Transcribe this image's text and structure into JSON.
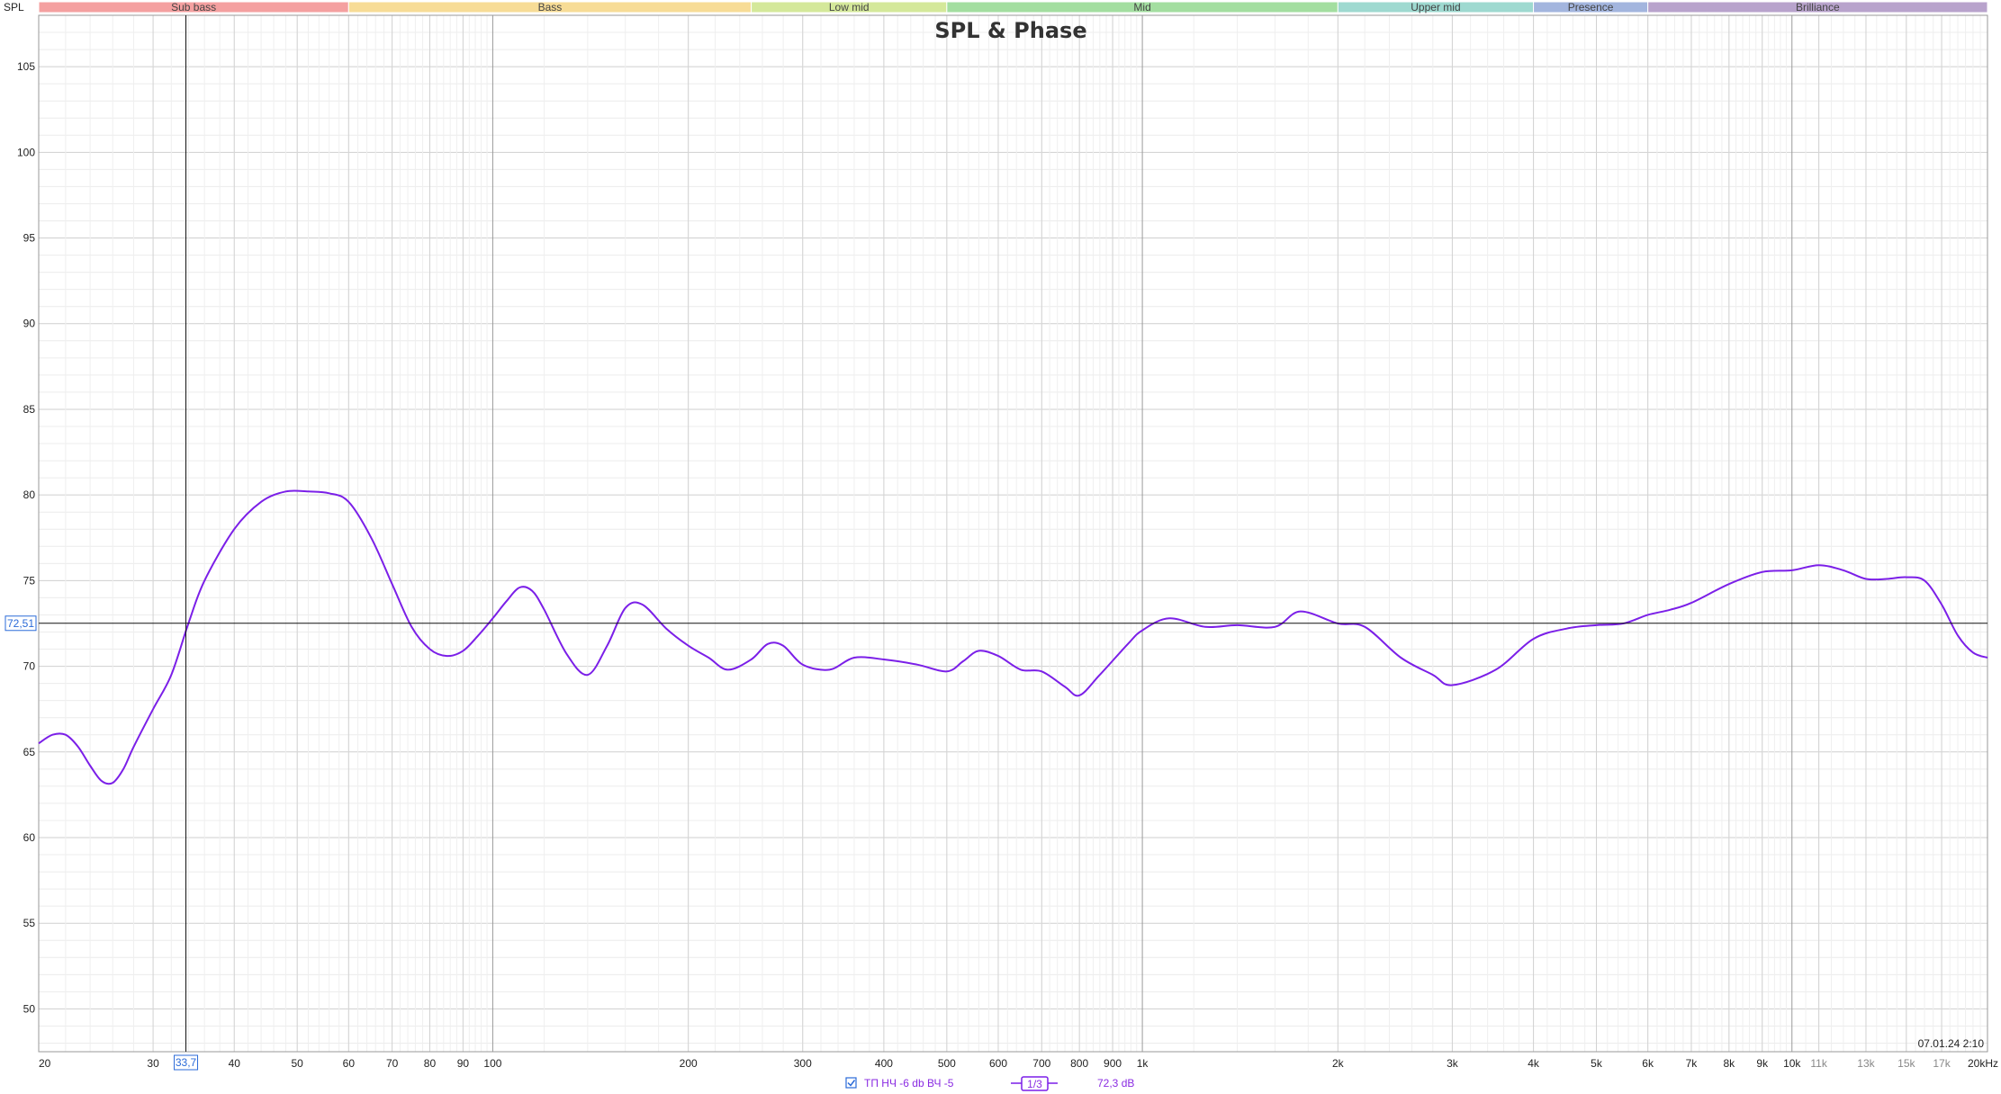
{
  "chart_data": {
    "type": "line",
    "title": "SPL & Phase",
    "ylabel": "SPL",
    "x_scale": "log",
    "xlim": [
      20,
      20000
    ],
    "ylim": [
      47.5,
      108
    ],
    "y_ticks": [
      50,
      55,
      60,
      65,
      70,
      75,
      80,
      85,
      90,
      95,
      100,
      105
    ],
    "x_ticks": [
      {
        "v": 20,
        "label": "20",
        "major": true
      },
      {
        "v": 30,
        "label": "30",
        "major": true
      },
      {
        "v": 40,
        "label": "40",
        "major": true
      },
      {
        "v": 50,
        "label": "50",
        "major": true
      },
      {
        "v": 60,
        "label": "60",
        "major": true
      },
      {
        "v": 70,
        "label": "70",
        "major": true
      },
      {
        "v": 80,
        "label": "80",
        "major": true
      },
      {
        "v": 90,
        "label": "90",
        "major": true
      },
      {
        "v": 100,
        "label": "100",
        "major": true
      },
      {
        "v": 200,
        "label": "200",
        "major": true
      },
      {
        "v": 300,
        "label": "300",
        "major": true
      },
      {
        "v": 400,
        "label": "400",
        "major": true
      },
      {
        "v": 500,
        "label": "500",
        "major": true
      },
      {
        "v": 600,
        "label": "600",
        "major": true
      },
      {
        "v": 700,
        "label": "700",
        "major": true
      },
      {
        "v": 800,
        "label": "800",
        "major": true
      },
      {
        "v": 900,
        "label": "900",
        "major": true
      },
      {
        "v": 1000,
        "label": "1k",
        "major": true
      },
      {
        "v": 2000,
        "label": "2k",
        "major": true
      },
      {
        "v": 3000,
        "label": "3k",
        "major": true
      },
      {
        "v": 4000,
        "label": "4k",
        "major": true
      },
      {
        "v": 5000,
        "label": "5k",
        "major": true
      },
      {
        "v": 6000,
        "label": "6k",
        "major": true
      },
      {
        "v": 7000,
        "label": "7k",
        "major": true
      },
      {
        "v": 8000,
        "label": "8k",
        "major": true
      },
      {
        "v": 9000,
        "label": "9k",
        "major": true
      },
      {
        "v": 10000,
        "label": "10k",
        "major": true
      },
      {
        "v": 11000,
        "label": "11k",
        "major": false
      },
      {
        "v": 13000,
        "label": "13k",
        "major": false
      },
      {
        "v": 15000,
        "label": "15k",
        "major": false
      },
      {
        "v": 17000,
        "label": "17k",
        "major": false
      },
      {
        "v": 20000,
        "label": "20kHz",
        "major": true
      }
    ],
    "bands": [
      {
        "label": "Sub bass",
        "from": 20,
        "to": 60,
        "color": "#f4a0a0"
      },
      {
        "label": "Bass",
        "from": 60,
        "to": 250,
        "color": "#f7dc96"
      },
      {
        "label": "Low mid",
        "from": 250,
        "to": 500,
        "color": "#d4e89a"
      },
      {
        "label": "Mid",
        "from": 500,
        "to": 2000,
        "color": "#a3dea0"
      },
      {
        "label": "Upper mid",
        "from": 2000,
        "to": 4000,
        "color": "#9ed9d0"
      },
      {
        "label": "Presence",
        "from": 4000,
        "to": 6000,
        "color": "#a3b5de"
      },
      {
        "label": "Brilliance",
        "from": 6000,
        "to": 20000,
        "color": "#b8a3cc"
      }
    ],
    "cursor": {
      "x": 33.7,
      "x_label": "33,7",
      "y": 72.51,
      "y_label": "72,51"
    },
    "timestamp": "07.01.24 2:10",
    "series": [
      {
        "name": "ТП НЧ -6 db ВЧ -5",
        "color": "#7b1fe8",
        "x": [
          20,
          21,
          22,
          23,
          24,
          25,
          26,
          27,
          28,
          30,
          32,
          34,
          36,
          40,
          44,
          48,
          52,
          56,
          60,
          65,
          70,
          75,
          80,
          85,
          90,
          95,
          100,
          105,
          110,
          115,
          120,
          130,
          140,
          150,
          160,
          170,
          185,
          200,
          215,
          230,
          250,
          265,
          280,
          300,
          330,
          360,
          400,
          450,
          500,
          530,
          560,
          600,
          650,
          700,
          760,
          800,
          860,
          950,
          1000,
          1100,
          1250,
          1400,
          1600,
          1750,
          2000,
          2200,
          2500,
          2800,
          3000,
          3500,
          4000,
          4500,
          5000,
          5500,
          6000,
          6500,
          7000,
          8000,
          9000,
          10000,
          11000,
          12000,
          13000,
          14000,
          15000,
          16000,
          17000,
          18000,
          19000,
          20000
        ],
        "y": [
          65.5,
          66.0,
          66.0,
          65.3,
          64.2,
          63.3,
          63.2,
          64.0,
          65.3,
          67.5,
          69.5,
          72.5,
          75.0,
          78.0,
          79.6,
          80.2,
          80.2,
          80.1,
          79.6,
          77.5,
          74.8,
          72.3,
          71.0,
          70.6,
          70.9,
          71.8,
          72.8,
          73.8,
          74.6,
          74.4,
          73.3,
          70.7,
          69.5,
          71.2,
          73.4,
          73.6,
          72.2,
          71.2,
          70.5,
          69.8,
          70.4,
          71.3,
          71.2,
          70.1,
          69.8,
          70.5,
          70.4,
          70.1,
          69.7,
          70.3,
          70.9,
          70.6,
          69.8,
          69.7,
          68.8,
          68.3,
          69.5,
          71.3,
          72.1,
          72.8,
          72.3,
          72.4,
          72.3,
          73.2,
          72.5,
          72.3,
          70.5,
          69.5,
          68.9,
          69.8,
          71.6,
          72.2,
          72.4,
          72.5,
          73.0,
          73.3,
          73.7,
          74.8,
          75.5,
          75.6,
          75.9,
          75.6,
          75.1,
          75.1,
          75.2,
          75.0,
          73.6,
          71.8,
          70.8,
          70.5
        ]
      }
    ]
  },
  "legend": {
    "series_label": "ТП НЧ -6 db ВЧ -5",
    "smoothing_label": "1/3",
    "level_label": "72,3 dB"
  }
}
